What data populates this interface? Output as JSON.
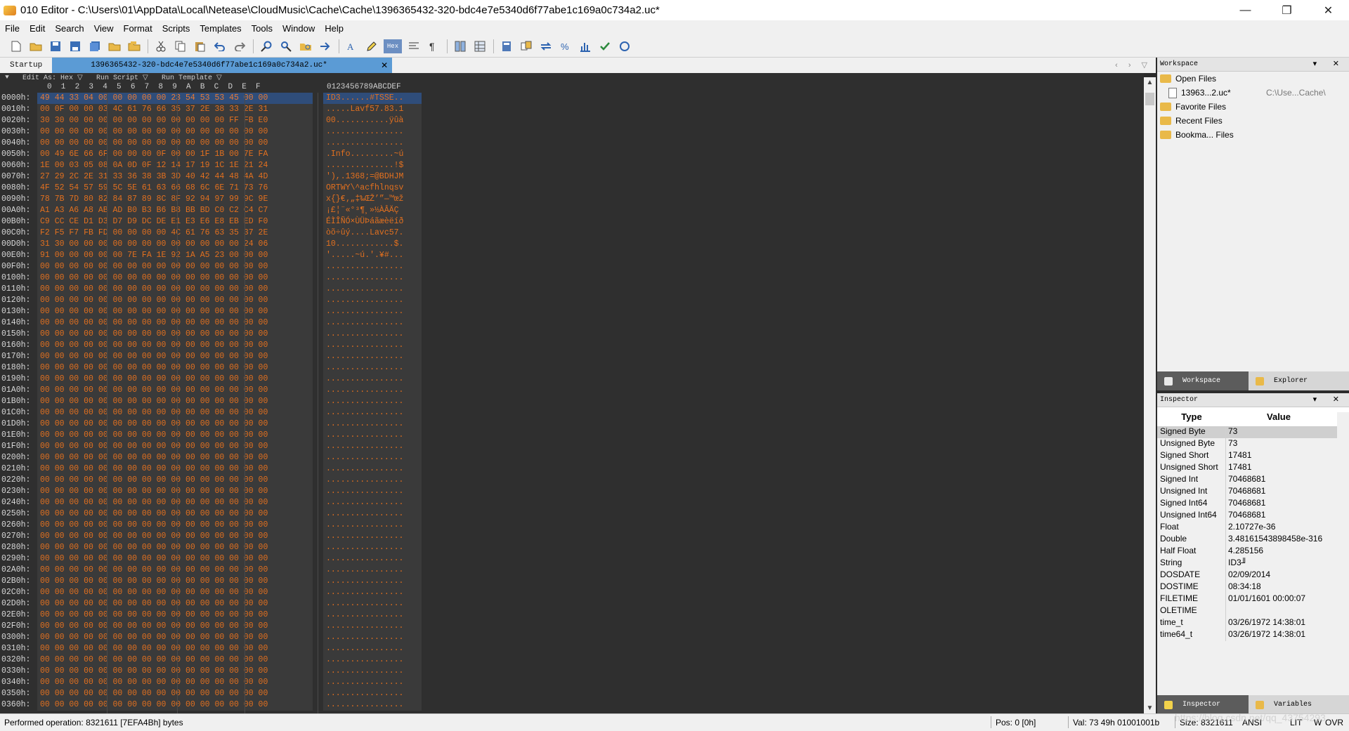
{
  "window": {
    "title": "010 Editor - C:\\Users\\01\\AppData\\Local\\Netease\\CloudMusic\\Cache\\Cache\\1396365432-320-bdc4e7e5340d6f77abe1c169a0c734a2.uc*",
    "min": "—",
    "max": "❐",
    "close": "✕"
  },
  "menu": [
    "File",
    "Edit",
    "Search",
    "View",
    "Format",
    "Scripts",
    "Templates",
    "Tools",
    "Window",
    "Help"
  ],
  "tabs": {
    "startup": "Startup",
    "active": "1396365432-320-bdc4e7e5340d6f77abe1c169a0c734a2.uc*",
    "close": "✕",
    "nav": "‹ › ▽"
  },
  "editor": {
    "edit_as": "Edit As: Hex ▽",
    "run_script": "Run Script ▽",
    "run_template": "Run Template ▽",
    "col_header_hex": "0  1  2  3  4  5  6  7  8  9  A  B  C  D  E  F",
    "col_header_ascii": "0123456789ABCDEF",
    "rows": [
      {
        "addr": "0000h:",
        "hex": "49 44 33 04 00 00 00 00 00 23 54 53 53 45 00 00",
        "asc": "ID3......#TSSE.."
      },
      {
        "addr": "0010h:",
        "hex": "00 0F 00 00 03 4C 61 76 66 35 37 2E 38 33 2E 31",
        "asc": ".....Lavf57.83.1"
      },
      {
        "addr": "0020h:",
        "hex": "30 30 00 00 00 00 00 00 00 00 00 00 00 FF FB E0",
        "asc": "00...........ÿûà"
      },
      {
        "addr": "0030h:",
        "hex": "00 00 00 00 00 00 00 00 00 00 00 00 00 00 00 00",
        "asc": "................"
      },
      {
        "addr": "0040h:",
        "hex": "00 00 00 00 00 00 00 00 00 00 00 00 00 00 00 00",
        "asc": "................"
      },
      {
        "addr": "0050h:",
        "hex": "00 49 6E 66 6F 00 00 00 0F 00 00 1F 1B 00 7E FA",
        "asc": ".Info.........~ú"
      },
      {
        "addr": "0060h:",
        "hex": "1E 00 03 05 08 0A 0D 0F 12 14 17 19 1C 1E 21 24",
        "asc": "..............!$"
      },
      {
        "addr": "0070h:",
        "hex": "27 29 2C 2E 31 33 36 38 3B 3D 40 42 44 48 4A 4D",
        "asc": "'),.1368;=@BDHJM"
      },
      {
        "addr": "0080h:",
        "hex": "4F 52 54 57 59 5C 5E 61 63 66 68 6C 6E 71 73 76",
        "asc": "ORTWY\\^acfhlnqsv"
      },
      {
        "addr": "0090h:",
        "hex": "78 7B 7D 80 82 84 87 89 8C 8F 92 94 97 99 9C 9E",
        "asc": "x{}€‚„‡‰ŒŽ’”—™œž"
      },
      {
        "addr": "00A0h:",
        "hex": "A1 A3 A6 A8 AB AD B0 B3 B6 B8 BB BD C0 C2 C4 C7",
        "asc": "¡£¦¨«­°³¶¸»½ÀÂÄÇ"
      },
      {
        "addr": "00B0h:",
        "hex": "C9 CC CE D1 D3 D7 D9 DC DE E1 E3 E6 E8 EB ED F0",
        "asc": "ÉÌÎÑÓ×ÙÜÞáãæèëíð"
      },
      {
        "addr": "00C0h:",
        "hex": "F2 F5 F7 FB FD 00 00 00 00 4C 61 76 63 35 37 2E",
        "asc": "òõ÷ûý....Lavc57."
      },
      {
        "addr": "00D0h:",
        "hex": "31 30 00 00 00 00 00 00 00 00 00 00 00 00 24 06",
        "asc": "10............$."
      },
      {
        "addr": "00E0h:",
        "hex": "91 00 00 00 00 00 7E FA 1E 92 1A A5 23 00 00 00",
        "asc": "'.....~ú.'.¥#..."
      },
      {
        "addr": "00F0h:",
        "hex": "00 00 00 00 00 00 00 00 00 00 00 00 00 00 00 00",
        "asc": "................"
      },
      {
        "addr": "0100h:",
        "hex": "00 00 00 00 00 00 00 00 00 00 00 00 00 00 00 00",
        "asc": "................"
      },
      {
        "addr": "0110h:",
        "hex": "00 00 00 00 00 00 00 00 00 00 00 00 00 00 00 00",
        "asc": "................"
      },
      {
        "addr": "0120h:",
        "hex": "00 00 00 00 00 00 00 00 00 00 00 00 00 00 00 00",
        "asc": "................"
      },
      {
        "addr": "0130h:",
        "hex": "00 00 00 00 00 00 00 00 00 00 00 00 00 00 00 00",
        "asc": "................"
      },
      {
        "addr": "0140h:",
        "hex": "00 00 00 00 00 00 00 00 00 00 00 00 00 00 00 00",
        "asc": "................"
      },
      {
        "addr": "0150h:",
        "hex": "00 00 00 00 00 00 00 00 00 00 00 00 00 00 00 00",
        "asc": "................"
      },
      {
        "addr": "0160h:",
        "hex": "00 00 00 00 00 00 00 00 00 00 00 00 00 00 00 00",
        "asc": "................"
      },
      {
        "addr": "0170h:",
        "hex": "00 00 00 00 00 00 00 00 00 00 00 00 00 00 00 00",
        "asc": "................"
      },
      {
        "addr": "0180h:",
        "hex": "00 00 00 00 00 00 00 00 00 00 00 00 00 00 00 00",
        "asc": "................"
      },
      {
        "addr": "0190h:",
        "hex": "00 00 00 00 00 00 00 00 00 00 00 00 00 00 00 00",
        "asc": "................"
      },
      {
        "addr": "01A0h:",
        "hex": "00 00 00 00 00 00 00 00 00 00 00 00 00 00 00 00",
        "asc": "................"
      },
      {
        "addr": "01B0h:",
        "hex": "00 00 00 00 00 00 00 00 00 00 00 00 00 00 00 00",
        "asc": "................"
      },
      {
        "addr": "01C0h:",
        "hex": "00 00 00 00 00 00 00 00 00 00 00 00 00 00 00 00",
        "asc": "................"
      },
      {
        "addr": "01D0h:",
        "hex": "00 00 00 00 00 00 00 00 00 00 00 00 00 00 00 00",
        "asc": "................"
      },
      {
        "addr": "01E0h:",
        "hex": "00 00 00 00 00 00 00 00 00 00 00 00 00 00 00 00",
        "asc": "................"
      },
      {
        "addr": "01F0h:",
        "hex": "00 00 00 00 00 00 00 00 00 00 00 00 00 00 00 00",
        "asc": "................"
      },
      {
        "addr": "0200h:",
        "hex": "00 00 00 00 00 00 00 00 00 00 00 00 00 00 00 00",
        "asc": "................"
      },
      {
        "addr": "0210h:",
        "hex": "00 00 00 00 00 00 00 00 00 00 00 00 00 00 00 00",
        "asc": "................"
      },
      {
        "addr": "0220h:",
        "hex": "00 00 00 00 00 00 00 00 00 00 00 00 00 00 00 00",
        "asc": "................"
      },
      {
        "addr": "0230h:",
        "hex": "00 00 00 00 00 00 00 00 00 00 00 00 00 00 00 00",
        "asc": "................"
      },
      {
        "addr": "0240h:",
        "hex": "00 00 00 00 00 00 00 00 00 00 00 00 00 00 00 00",
        "asc": "................"
      },
      {
        "addr": "0250h:",
        "hex": "00 00 00 00 00 00 00 00 00 00 00 00 00 00 00 00",
        "asc": "................"
      },
      {
        "addr": "0260h:",
        "hex": "00 00 00 00 00 00 00 00 00 00 00 00 00 00 00 00",
        "asc": "................"
      },
      {
        "addr": "0270h:",
        "hex": "00 00 00 00 00 00 00 00 00 00 00 00 00 00 00 00",
        "asc": "................"
      },
      {
        "addr": "0280h:",
        "hex": "00 00 00 00 00 00 00 00 00 00 00 00 00 00 00 00",
        "asc": "................"
      },
      {
        "addr": "0290h:",
        "hex": "00 00 00 00 00 00 00 00 00 00 00 00 00 00 00 00",
        "asc": "................"
      },
      {
        "addr": "02A0h:",
        "hex": "00 00 00 00 00 00 00 00 00 00 00 00 00 00 00 00",
        "asc": "................"
      },
      {
        "addr": "02B0h:",
        "hex": "00 00 00 00 00 00 00 00 00 00 00 00 00 00 00 00",
        "asc": "................"
      },
      {
        "addr": "02C0h:",
        "hex": "00 00 00 00 00 00 00 00 00 00 00 00 00 00 00 00",
        "asc": "................"
      },
      {
        "addr": "02D0h:",
        "hex": "00 00 00 00 00 00 00 00 00 00 00 00 00 00 00 00",
        "asc": "................"
      },
      {
        "addr": "02E0h:",
        "hex": "00 00 00 00 00 00 00 00 00 00 00 00 00 00 00 00",
        "asc": "................"
      },
      {
        "addr": "02F0h:",
        "hex": "00 00 00 00 00 00 00 00 00 00 00 00 00 00 00 00",
        "asc": "................"
      },
      {
        "addr": "0300h:",
        "hex": "00 00 00 00 00 00 00 00 00 00 00 00 00 00 00 00",
        "asc": "................"
      },
      {
        "addr": "0310h:",
        "hex": "00 00 00 00 00 00 00 00 00 00 00 00 00 00 00 00",
        "asc": "................"
      },
      {
        "addr": "0320h:",
        "hex": "00 00 00 00 00 00 00 00 00 00 00 00 00 00 00 00",
        "asc": "................"
      },
      {
        "addr": "0330h:",
        "hex": "00 00 00 00 00 00 00 00 00 00 00 00 00 00 00 00",
        "asc": "................"
      },
      {
        "addr": "0340h:",
        "hex": "00 00 00 00 00 00 00 00 00 00 00 00 00 00 00 00",
        "asc": "................"
      },
      {
        "addr": "0350h:",
        "hex": "00 00 00 00 00 00 00 00 00 00 00 00 00 00 00 00",
        "asc": "................"
      },
      {
        "addr": "0360h:",
        "hex": "00 00 00 00 00 00 00 00 00 00 00 00 00 00 00 00",
        "asc": "................"
      }
    ]
  },
  "workspace": {
    "title": "Workspace",
    "ctrls": "▾ ✕",
    "open_files": "Open Files",
    "open_file_name": "13963...2.uc*",
    "open_file_path": "C:\\Use...Cache\\",
    "favorite_files": "Favorite Files",
    "recent_files": "Recent Files",
    "bookmarked_files": "Bookma... Files",
    "tab_workspace": "Workspace",
    "tab_explorer": "Explorer"
  },
  "inspector": {
    "title": "Inspector",
    "ctrls": "▾ ✕",
    "col_type": "Type",
    "col_value": "Value",
    "rows": [
      {
        "type": "Signed Byte",
        "value": "73"
      },
      {
        "type": "Unsigned Byte",
        "value": "73"
      },
      {
        "type": "Signed Short",
        "value": "17481"
      },
      {
        "type": "Unsigned Short",
        "value": "17481"
      },
      {
        "type": "Signed Int",
        "value": "70468681"
      },
      {
        "type": "Unsigned Int",
        "value": "70468681"
      },
      {
        "type": "Signed Int64",
        "value": "70468681"
      },
      {
        "type": "Unsigned Int64",
        "value": "70468681"
      },
      {
        "type": "Float",
        "value": "2.10727e-36"
      },
      {
        "type": "Double",
        "value": "3.48161543898458e-316"
      },
      {
        "type": "Half Float",
        "value": "4.285156"
      },
      {
        "type": "String",
        "value": "ID3╜"
      },
      {
        "type": "DOSDATE",
        "value": "02/09/2014"
      },
      {
        "type": "DOSTIME",
        "value": "08:34:18"
      },
      {
        "type": "FILETIME",
        "value": "01/01/1601 00:00:07"
      },
      {
        "type": "OLETIME",
        "value": ""
      },
      {
        "type": "time_t",
        "value": "03/26/1972 14:38:01"
      },
      {
        "type": "time64_t",
        "value": "03/26/1972 14:38:01"
      }
    ],
    "tab_inspector": "Inspector",
    "tab_variables": "Variables"
  },
  "status": {
    "message": "Performed operation: 8321611 [7EFA4Bh] bytes",
    "pos": "Pos: 0 [0h]",
    "val": "Val: 73 49h 01001001b",
    "size": "Size: 8321611",
    "encoding": "ANSI",
    "lit": "LIT",
    "w": "W",
    "ovr": "OVR",
    "watermark": "https://blog.csdn.net/qq_43754293"
  },
  "colors": {
    "hex_text": "#e2701f",
    "selection": "#2f4d7a",
    "active_tab": "#5b9bd5"
  }
}
